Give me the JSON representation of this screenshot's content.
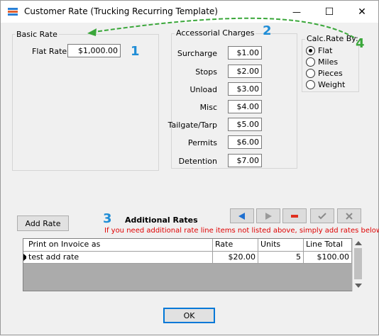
{
  "window": {
    "title": "Customer Rate (Trucking Recurring Template)",
    "minimize_glyph": "—",
    "maximize_glyph": "☐",
    "close_glyph": "✕"
  },
  "basic_rate": {
    "group_label": "Basic Rate",
    "flat_rate_label": "Flat Rate",
    "flat_rate_value": "$1,000.00"
  },
  "accessorial": {
    "group_label": "Accessorial Charges",
    "items": [
      {
        "label": "Surcharge",
        "value": "$1.00"
      },
      {
        "label": "Stops",
        "value": "$2.00"
      },
      {
        "label": "Unload",
        "value": "$3.00"
      },
      {
        "label": "Misc",
        "value": "$4.00"
      },
      {
        "label": "Tailgate/Tarp",
        "value": "$5.00"
      },
      {
        "label": "Permits",
        "value": "$6.00"
      },
      {
        "label": "Detention",
        "value": "$7.00"
      }
    ]
  },
  "calc_rate": {
    "group_label": "Calc.Rate By:",
    "options": [
      "Flat",
      "Miles",
      "Pieces",
      "Weight"
    ],
    "selected": "Flat"
  },
  "annotations": {
    "n1": "1",
    "n2": "2",
    "n3": "3",
    "n4": "4",
    "blue": "#1f8dd6",
    "green": "#3aa73a"
  },
  "additional": {
    "add_rate_label": "Add Rate",
    "title": "Additional Rates",
    "note": "If you need additional rate line items not listed above, simply add rates below",
    "nav_icons": [
      "prev-icon",
      "next-icon",
      "delete-icon",
      "confirm-icon",
      "cancel-icon"
    ],
    "columns": [
      "Print on Invoice as",
      "Rate",
      "Units",
      "Line Total"
    ],
    "rows": [
      {
        "print_as": "test add rate",
        "rate": "$20.00",
        "units": "5",
        "line_total": "$100.00"
      }
    ]
  },
  "ok_label": "OK",
  "colors": {
    "note_red": "#e00000",
    "nav_blue": "#1e6fd0",
    "nav_red": "#e03020",
    "arrow_green": "#3aa73a"
  }
}
